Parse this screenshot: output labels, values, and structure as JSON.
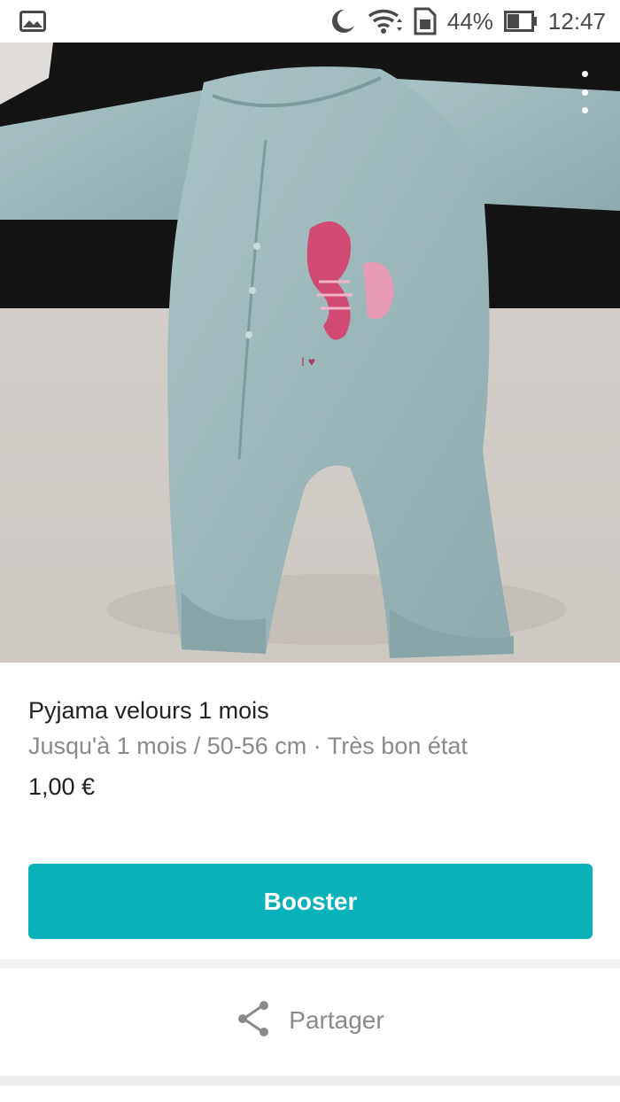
{
  "status_bar": {
    "notification_icon": "image-icon",
    "icons": [
      "moon-icon",
      "wifi-icon",
      "sim-card-icon",
      "battery-icon"
    ],
    "battery_percent": "44%",
    "time": "12:47"
  },
  "photo": {
    "subject": "baby-pyjama-photo",
    "menu_icon": "more-vertical-icon"
  },
  "item": {
    "title": "Pyjama velours 1 mois",
    "details": "Jusqu'à 1 mois / 50-56 cm · Très bon état",
    "price": "1,00 €"
  },
  "actions": {
    "boost_label": "Booster",
    "share_label": "Partager",
    "share_icon": "share-icon"
  },
  "colors": {
    "accent": "#09b1ba",
    "text_primary": "#222222",
    "text_secondary": "#8a8a8a"
  }
}
